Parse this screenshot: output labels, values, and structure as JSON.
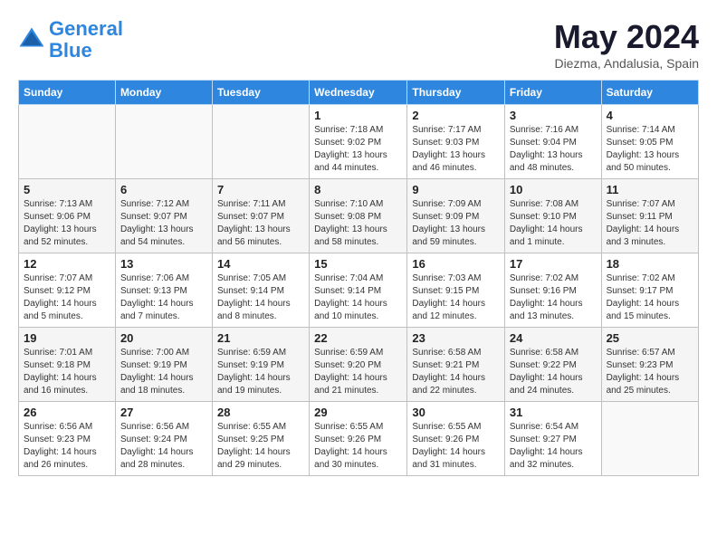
{
  "header": {
    "logo_line1": "General",
    "logo_line2": "Blue",
    "month": "May 2024",
    "location": "Diezma, Andalusia, Spain"
  },
  "weekdays": [
    "Sunday",
    "Monday",
    "Tuesday",
    "Wednesday",
    "Thursday",
    "Friday",
    "Saturday"
  ],
  "weeks": [
    [
      {
        "day": "",
        "info": ""
      },
      {
        "day": "",
        "info": ""
      },
      {
        "day": "",
        "info": ""
      },
      {
        "day": "1",
        "info": "Sunrise: 7:18 AM\nSunset: 9:02 PM\nDaylight: 13 hours\nand 44 minutes."
      },
      {
        "day": "2",
        "info": "Sunrise: 7:17 AM\nSunset: 9:03 PM\nDaylight: 13 hours\nand 46 minutes."
      },
      {
        "day": "3",
        "info": "Sunrise: 7:16 AM\nSunset: 9:04 PM\nDaylight: 13 hours\nand 48 minutes."
      },
      {
        "day": "4",
        "info": "Sunrise: 7:14 AM\nSunset: 9:05 PM\nDaylight: 13 hours\nand 50 minutes."
      }
    ],
    [
      {
        "day": "5",
        "info": "Sunrise: 7:13 AM\nSunset: 9:06 PM\nDaylight: 13 hours\nand 52 minutes."
      },
      {
        "day": "6",
        "info": "Sunrise: 7:12 AM\nSunset: 9:07 PM\nDaylight: 13 hours\nand 54 minutes."
      },
      {
        "day": "7",
        "info": "Sunrise: 7:11 AM\nSunset: 9:07 PM\nDaylight: 13 hours\nand 56 minutes."
      },
      {
        "day": "8",
        "info": "Sunrise: 7:10 AM\nSunset: 9:08 PM\nDaylight: 13 hours\nand 58 minutes."
      },
      {
        "day": "9",
        "info": "Sunrise: 7:09 AM\nSunset: 9:09 PM\nDaylight: 13 hours\nand 59 minutes."
      },
      {
        "day": "10",
        "info": "Sunrise: 7:08 AM\nSunset: 9:10 PM\nDaylight: 14 hours\nand 1 minute."
      },
      {
        "day": "11",
        "info": "Sunrise: 7:07 AM\nSunset: 9:11 PM\nDaylight: 14 hours\nand 3 minutes."
      }
    ],
    [
      {
        "day": "12",
        "info": "Sunrise: 7:07 AM\nSunset: 9:12 PM\nDaylight: 14 hours\nand 5 minutes."
      },
      {
        "day": "13",
        "info": "Sunrise: 7:06 AM\nSunset: 9:13 PM\nDaylight: 14 hours\nand 7 minutes."
      },
      {
        "day": "14",
        "info": "Sunrise: 7:05 AM\nSunset: 9:14 PM\nDaylight: 14 hours\nand 8 minutes."
      },
      {
        "day": "15",
        "info": "Sunrise: 7:04 AM\nSunset: 9:14 PM\nDaylight: 14 hours\nand 10 minutes."
      },
      {
        "day": "16",
        "info": "Sunrise: 7:03 AM\nSunset: 9:15 PM\nDaylight: 14 hours\nand 12 minutes."
      },
      {
        "day": "17",
        "info": "Sunrise: 7:02 AM\nSunset: 9:16 PM\nDaylight: 14 hours\nand 13 minutes."
      },
      {
        "day": "18",
        "info": "Sunrise: 7:02 AM\nSunset: 9:17 PM\nDaylight: 14 hours\nand 15 minutes."
      }
    ],
    [
      {
        "day": "19",
        "info": "Sunrise: 7:01 AM\nSunset: 9:18 PM\nDaylight: 14 hours\nand 16 minutes."
      },
      {
        "day": "20",
        "info": "Sunrise: 7:00 AM\nSunset: 9:19 PM\nDaylight: 14 hours\nand 18 minutes."
      },
      {
        "day": "21",
        "info": "Sunrise: 6:59 AM\nSunset: 9:19 PM\nDaylight: 14 hours\nand 19 minutes."
      },
      {
        "day": "22",
        "info": "Sunrise: 6:59 AM\nSunset: 9:20 PM\nDaylight: 14 hours\nand 21 minutes."
      },
      {
        "day": "23",
        "info": "Sunrise: 6:58 AM\nSunset: 9:21 PM\nDaylight: 14 hours\nand 22 minutes."
      },
      {
        "day": "24",
        "info": "Sunrise: 6:58 AM\nSunset: 9:22 PM\nDaylight: 14 hours\nand 24 minutes."
      },
      {
        "day": "25",
        "info": "Sunrise: 6:57 AM\nSunset: 9:23 PM\nDaylight: 14 hours\nand 25 minutes."
      }
    ],
    [
      {
        "day": "26",
        "info": "Sunrise: 6:56 AM\nSunset: 9:23 PM\nDaylight: 14 hours\nand 26 minutes."
      },
      {
        "day": "27",
        "info": "Sunrise: 6:56 AM\nSunset: 9:24 PM\nDaylight: 14 hours\nand 28 minutes."
      },
      {
        "day": "28",
        "info": "Sunrise: 6:55 AM\nSunset: 9:25 PM\nDaylight: 14 hours\nand 29 minutes."
      },
      {
        "day": "29",
        "info": "Sunrise: 6:55 AM\nSunset: 9:26 PM\nDaylight: 14 hours\nand 30 minutes."
      },
      {
        "day": "30",
        "info": "Sunrise: 6:55 AM\nSunset: 9:26 PM\nDaylight: 14 hours\nand 31 minutes."
      },
      {
        "day": "31",
        "info": "Sunrise: 6:54 AM\nSunset: 9:27 PM\nDaylight: 14 hours\nand 32 minutes."
      },
      {
        "day": "",
        "info": ""
      }
    ]
  ]
}
